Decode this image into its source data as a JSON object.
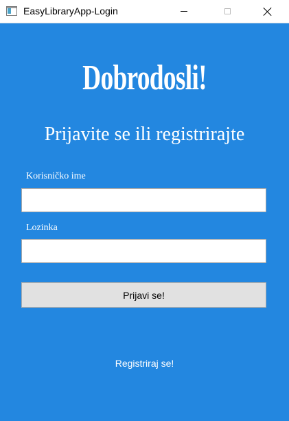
{
  "window": {
    "title": "EasyLibraryApp-Login"
  },
  "colors": {
    "background": "#2387e0",
    "text": "#ffffff",
    "button": "#e1e1e1"
  },
  "main": {
    "heading": "Dobrodosli!",
    "subtitle": "Prijavite se ili registrirajte",
    "username_label": "Korisničko ime",
    "username_value": "",
    "password_label": "Lozinka",
    "password_value": "",
    "login_button": "Prijavi se!",
    "register_link": "Registriraj se!"
  }
}
